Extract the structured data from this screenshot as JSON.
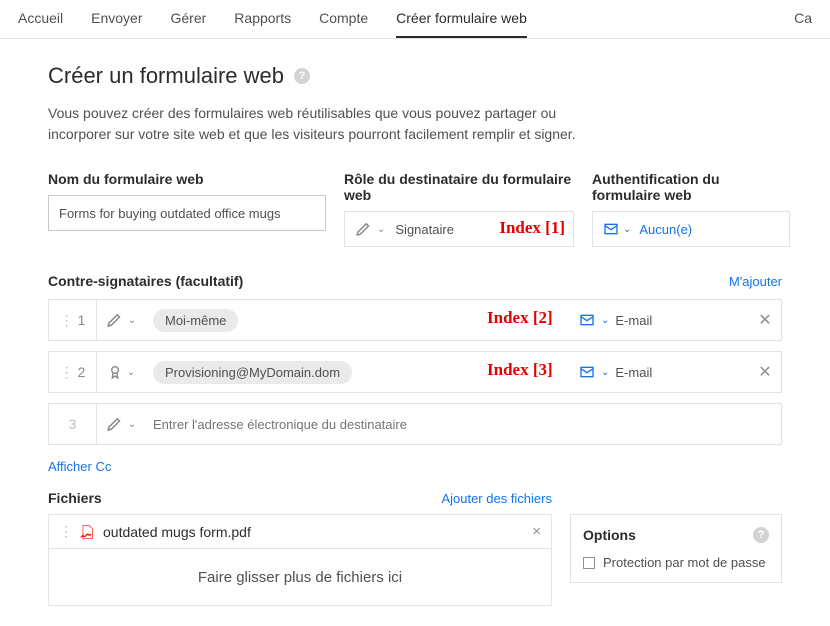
{
  "nav": {
    "items": [
      "Accueil",
      "Envoyer",
      "Gérer",
      "Rapports",
      "Compte",
      "Créer formulaire web"
    ],
    "right": "Ca"
  },
  "page": {
    "title": "Créer un formulaire web",
    "desc": "Vous pouvez créer des formulaires web réutilisables que vous pouvez partager ou incorporer sur votre site web et que les visiteurs pourront facilement remplir et signer."
  },
  "form_name": {
    "label": "Nom du formulaire web",
    "value": "Forms for buying outdated office mugs"
  },
  "role": {
    "label": "Rôle du destinataire du formulaire web",
    "value": "Signataire"
  },
  "auth": {
    "label": "Authentification du formulaire web",
    "value": "Aucun(e)"
  },
  "annotations": {
    "idx1": "Index [1]",
    "idx2": "Index [2]",
    "idx3": "Index [3]"
  },
  "cs": {
    "label": "Contre-signataires (facultatif)",
    "add": "M'ajouter",
    "rows": [
      {
        "num": "1",
        "chip": "Moi-même",
        "auth": "E-mail"
      },
      {
        "num": "2",
        "chip": "Provisioning@MyDomain.dom",
        "auth": "E-mail"
      },
      {
        "num": "3",
        "placeholder": "Entrer l'adresse électronique du destinataire"
      }
    ],
    "afficher_cc": "Afficher Cc"
  },
  "files": {
    "label": "Fichiers",
    "add": "Ajouter des fichiers",
    "items": [
      "outdated mugs form.pdf"
    ],
    "dropzone": "Faire glisser plus de fichiers ici"
  },
  "options": {
    "title": "Options",
    "pwd": "Protection par mot de passe"
  }
}
